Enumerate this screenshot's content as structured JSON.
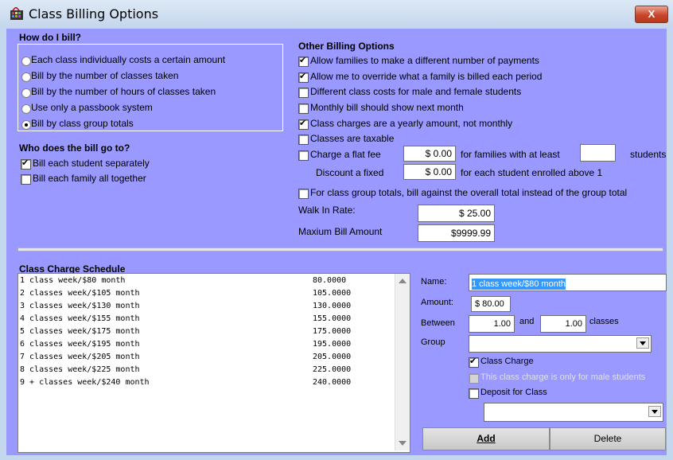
{
  "window": {
    "title": "Class Billing Options",
    "close_label": "X"
  },
  "how_bill": {
    "heading": "How do I bill?",
    "options": [
      "Each class individually costs a certain amount",
      "Bill by the number of classes taken",
      "Bill by the number of hours of classes taken",
      "Use only a passbook system",
      "Bill by class group totals"
    ],
    "selected_index": 4
  },
  "bill_to": {
    "heading": "Who does the bill go to?",
    "options": [
      {
        "label": "Bill each student separately",
        "checked": true
      },
      {
        "label": "Bill each family all together",
        "checked": false
      }
    ]
  },
  "other": {
    "heading": "Other Billing Options",
    "options": [
      {
        "label": "Allow families to make a different number of payments",
        "checked": true
      },
      {
        "label": "Allow me to override what a family is billed each period",
        "checked": true
      },
      {
        "label": "Different class costs for male and female students",
        "checked": false
      },
      {
        "label": "Monthly bill should show next month",
        "checked": false
      },
      {
        "label": "Class charges are a yearly amount, not monthly",
        "checked": true
      },
      {
        "label": "Classes are taxable",
        "checked": false
      }
    ],
    "flat_fee": {
      "label": "Charge a flat fee",
      "value": "$ 0.00",
      "suffix": "for families  with at least",
      "students_value": "",
      "students_label": "students"
    },
    "discount": {
      "label": "Discount a fixed",
      "value": "$ 0.00",
      "suffix": "for each student enrolled above 1"
    },
    "group_total": {
      "label": "For class group totals, bill against the overall total instead of the group total",
      "checked": false
    },
    "walk_in": {
      "label": "Walk In Rate:",
      "value": "$ 25.00"
    },
    "max_bill": {
      "label": "Maxium Bill Amount",
      "value": "$9999.99"
    }
  },
  "schedule": {
    "heading": "Class Charge Schedule",
    "rows": [
      {
        "name": "1 class week/$80 month",
        "amount": "80.0000"
      },
      {
        "name": "2 classes week/$105 month",
        "amount": "105.0000"
      },
      {
        "name": "3 classes week/$130 month",
        "amount": "130.0000"
      },
      {
        "name": "4 classes week/$155 month",
        "amount": "155.0000"
      },
      {
        "name": "5 classes week/$175 month",
        "amount": "175.0000"
      },
      {
        "name": "6 classes week/$195 month",
        "amount": "195.0000"
      },
      {
        "name": "7 classes week/$205 month",
        "amount": "205.0000"
      },
      {
        "name": "8 classes week/$225 month",
        "amount": "225.0000"
      },
      {
        "name": "9 + classes week/$240 month",
        "amount": "240.0000"
      }
    ]
  },
  "detail": {
    "name_label": "Name:",
    "name_value": "1 class week/$80 month",
    "amount_label": "Amount:",
    "amount_value": "$ 80.00",
    "between_label": "Between",
    "between_from": "1.00",
    "and_label": "and",
    "between_to": "1.00",
    "classes_label": "classes",
    "group_label": "Group",
    "group_value": "",
    "class_charge": {
      "label": "Class Charge",
      "checked": true
    },
    "male_only": {
      "label": "This class charge is only for male students",
      "checked": false
    },
    "deposit": {
      "label": "Deposit for Class",
      "checked": false
    },
    "deposit_value": "",
    "add_label": "Add",
    "delete_label": "Delete"
  },
  "colors": {
    "client_bg": "#9999ff",
    "selection_bg": "#3399ff"
  }
}
